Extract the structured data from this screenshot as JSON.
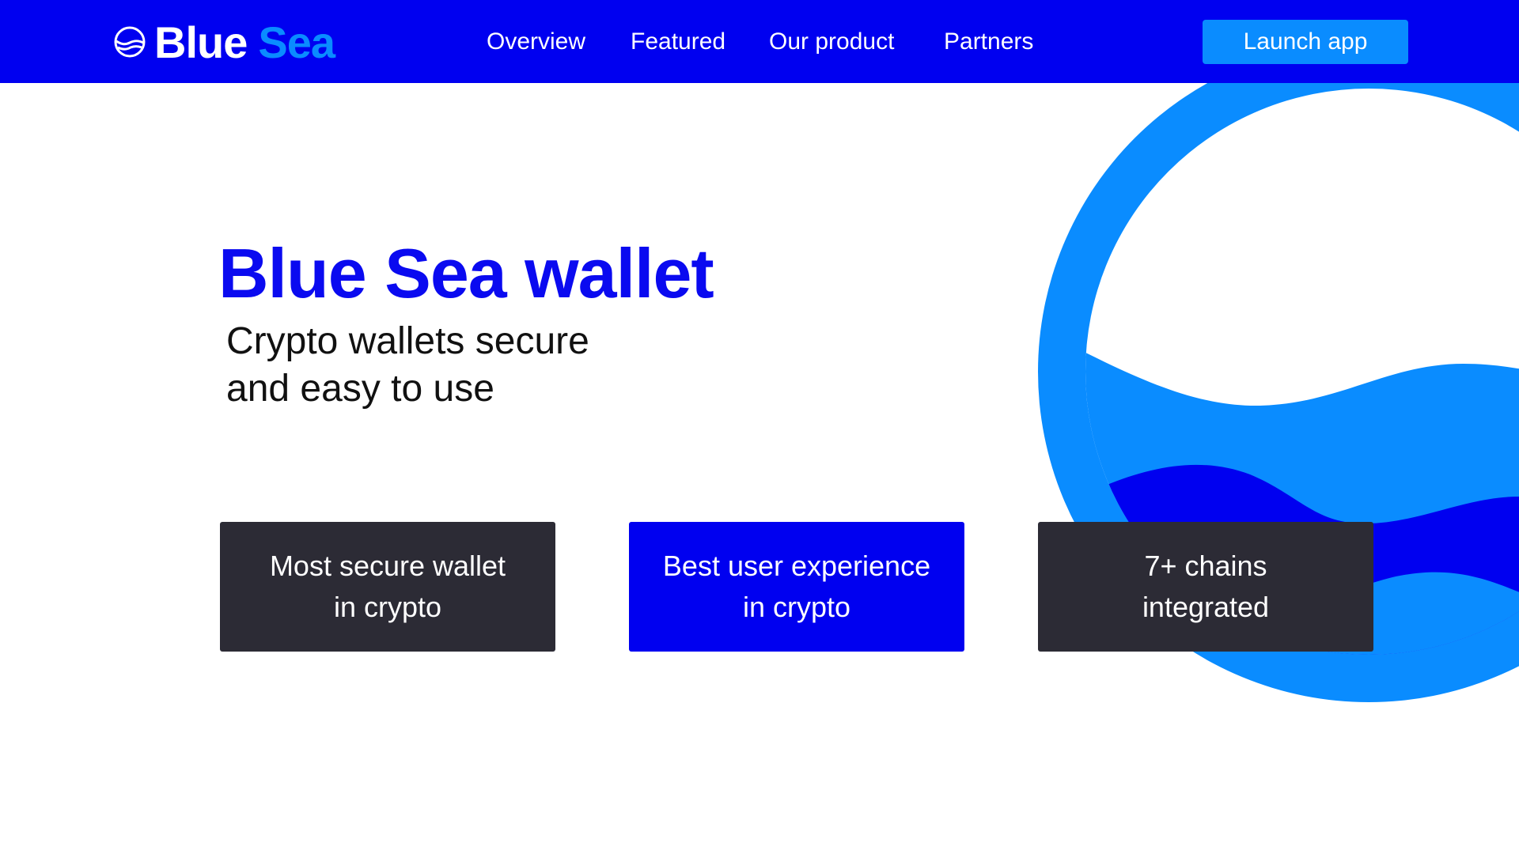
{
  "header": {
    "logo": {
      "icon": "wave-globe-icon",
      "word_1": "Blue",
      "word_2": "Sea"
    },
    "nav": [
      {
        "label": "Overview"
      },
      {
        "label": "Featured"
      },
      {
        "label": "Our product"
      },
      {
        "label": "Partners"
      }
    ],
    "cta_label": "Launch app"
  },
  "hero": {
    "title": "Blue Sea wallet",
    "subtitle_line_1": "Crypto wallets secure",
    "subtitle_line_2": "and easy to use"
  },
  "features": [
    {
      "line_1": "Most secure wallet",
      "line_2": "in crypto"
    },
    {
      "line_1": "Best user experience",
      "line_2": "in crypto"
    },
    {
      "line_1": "7+ chains",
      "line_2": "integrated"
    }
  ],
  "colors": {
    "header_bg": "#0000f0",
    "brand_blue": "#0a0af0",
    "accent_light_blue": "#0a8cff",
    "card_dark": "#2c2b35",
    "decor_circle": "#0a8cff",
    "decor_wave_dark": "#0000f0"
  }
}
